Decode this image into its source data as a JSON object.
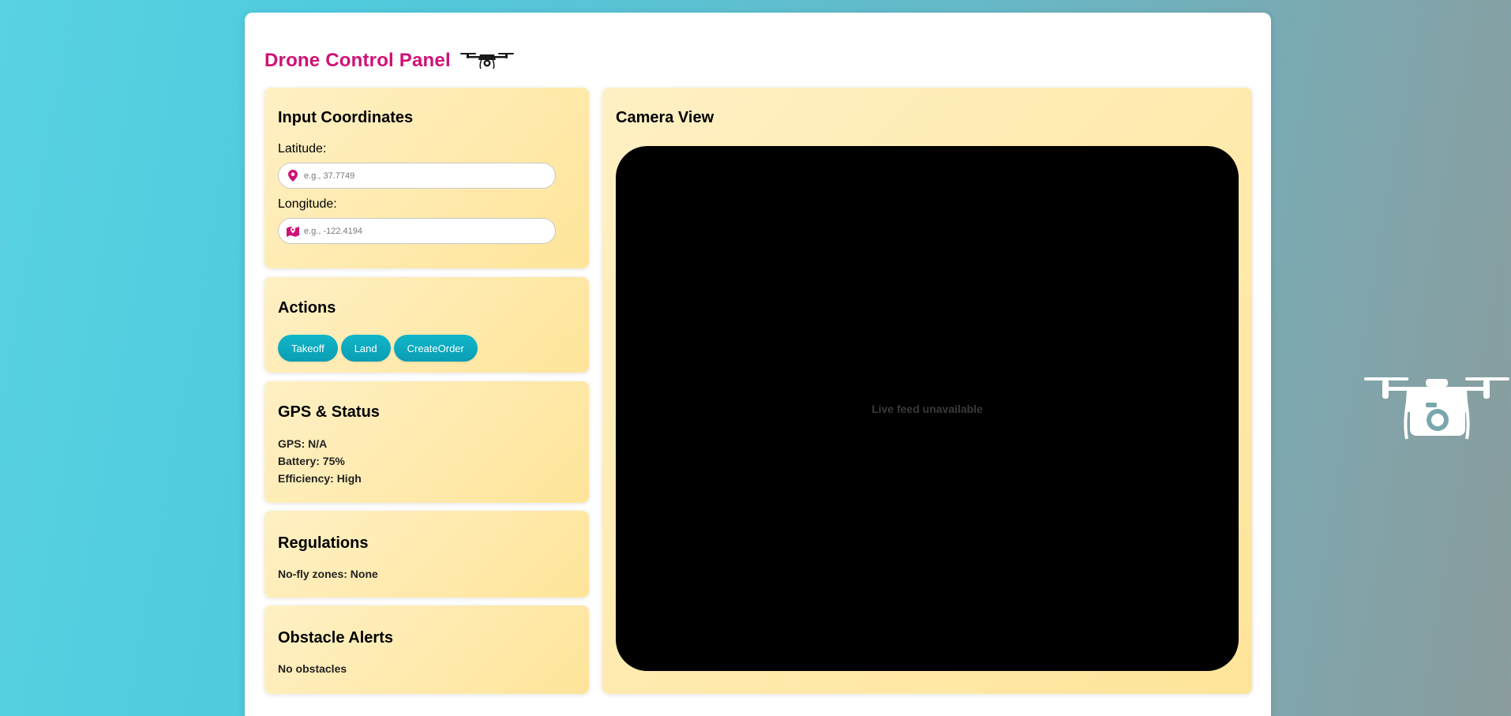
{
  "header": {
    "title": "Drone Control Panel",
    "title_icon": "drone-icon"
  },
  "background": {
    "decoration_icon": "camera-drone-icon"
  },
  "coordinates": {
    "heading": "Input Coordinates",
    "latitude": {
      "label": "Latitude:",
      "placeholder": "e.g., 37.7749",
      "value": "",
      "icon": "map-pin-icon"
    },
    "longitude": {
      "label": "Longitude:",
      "placeholder": "e.g., -122.4194",
      "value": "",
      "icon": "map-icon"
    }
  },
  "actions": {
    "heading": "Actions",
    "buttons": [
      {
        "label": "Takeoff"
      },
      {
        "label": "Land"
      },
      {
        "label": "CreateOrder"
      }
    ]
  },
  "gps_status": {
    "heading": "GPS & Status",
    "gps": "GPS: N/A",
    "battery": "Battery: 75%",
    "efficiency": "Efficiency: High"
  },
  "regulations": {
    "heading": "Regulations",
    "no_fly_zones": "No-fly zones: None"
  },
  "obstacles": {
    "heading": "Obstacle Alerts",
    "status": "No obstacles"
  },
  "camera": {
    "heading": "Camera View",
    "feed_status": "Live feed unavailable"
  },
  "colors": {
    "accent": "#d01175",
    "button": "#0ea9bd",
    "card": "#ffe9a8",
    "camera_bg": "#000000"
  }
}
